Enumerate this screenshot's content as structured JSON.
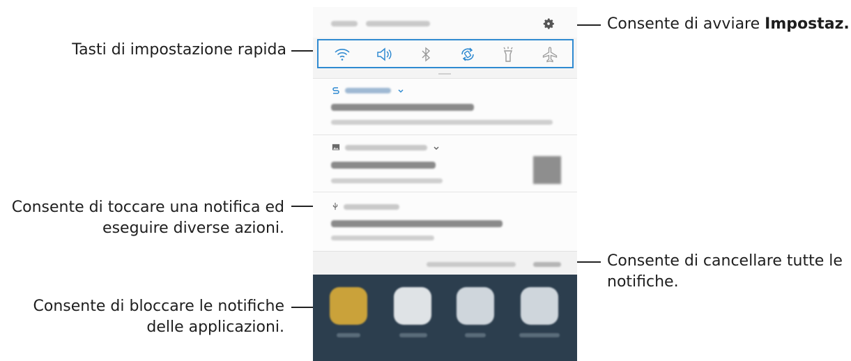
{
  "annotations": {
    "settings_prefix": "Consente di avviare ",
    "settings_bold": "Impostaz.",
    "quick_settings": "Tasti di impostazione rapida",
    "notification_line1": "Consente di toccare una notifica ed",
    "notification_line2": "eseguire diverse azioni.",
    "clear_line1": "Consente di cancellare tutte le",
    "clear_line2": "notifiche.",
    "block_line1": "Consente di bloccare le notifiche",
    "block_line2": "delle applicazioni."
  },
  "quick_settings": {
    "icons": [
      "wifi-icon",
      "sound-icon",
      "bluetooth-icon",
      "auto-rotate-icon",
      "flashlight-icon",
      "airplane-mode-icon"
    ],
    "active_color": "#2f8ad1",
    "inactive_color": "#9a9a9a"
  },
  "status_bar": {
    "icons": [
      "gear-icon"
    ]
  },
  "notifications": {
    "icons": [
      "smart-switch-icon",
      "image-icon",
      "usb-icon"
    ]
  },
  "colors": {
    "highlight_border": "#2f8ad1",
    "home_background": "#2c3e4e"
  }
}
